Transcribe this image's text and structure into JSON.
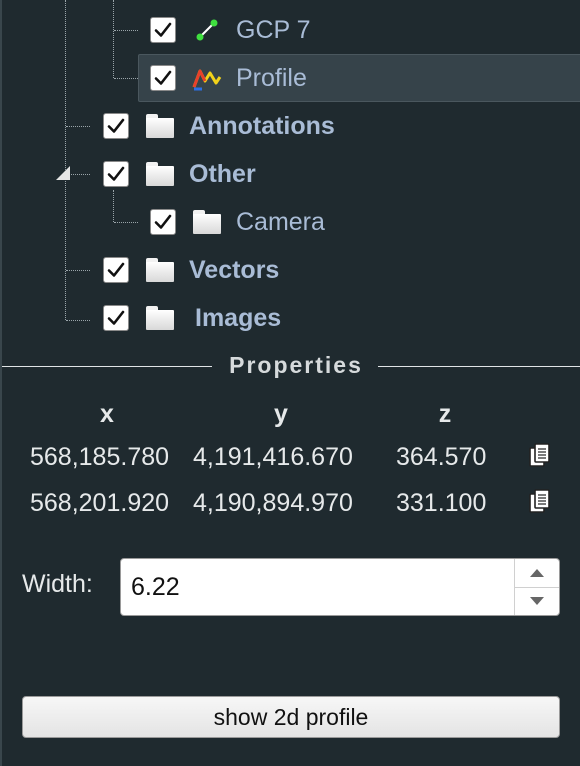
{
  "tree": {
    "items": [
      {
        "label": "GCP 7",
        "icon": "gcp-point-icon",
        "checked": true,
        "bold": false
      },
      {
        "label": "Profile",
        "icon": "profile-icon",
        "checked": true,
        "bold": false,
        "selected": true
      },
      {
        "label": "Annotations",
        "icon": "folder-icon",
        "checked": true,
        "bold": true
      },
      {
        "label": "Other",
        "icon": "folder-icon",
        "checked": true,
        "bold": true,
        "expanded": true
      },
      {
        "label": "Camera",
        "icon": "folder-icon",
        "checked": true,
        "bold": false
      },
      {
        "label": "Vectors",
        "icon": "folder-icon",
        "checked": true,
        "bold": true
      },
      {
        "label": "Images",
        "icon": "folder-icon",
        "checked": true,
        "bold": true
      }
    ]
  },
  "properties": {
    "title": "Properties",
    "columns": [
      "x",
      "y",
      "z"
    ],
    "rows": [
      {
        "x": "568,185.780",
        "y": "4,191,416.670",
        "z": "364.570",
        "action_icon": "copy-icon"
      },
      {
        "x": "568,201.920",
        "y": "4,190,894.970",
        "z": "331.100",
        "action_icon": "copy-icon"
      }
    ],
    "width_label": "Width:",
    "width_value": "6.22",
    "profile_button_label": "show 2d profile"
  },
  "colors": {
    "background": "#1f2a2f",
    "tree_label": "#a9bcd6",
    "selected_row": "#36434a"
  }
}
